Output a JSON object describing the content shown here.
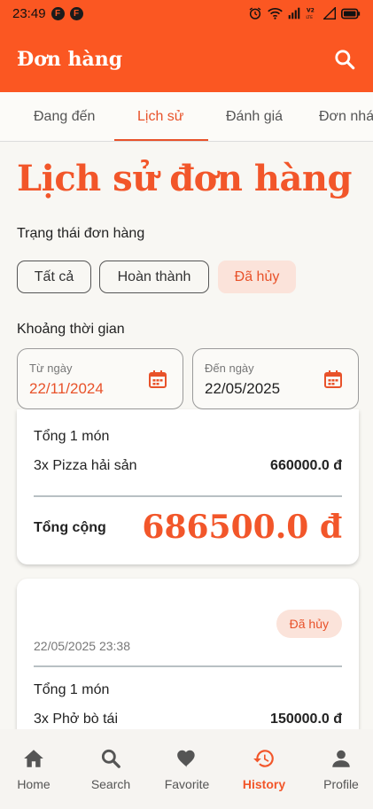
{
  "status_bar": {
    "time": "23:49",
    "icons": [
      "notification-icon",
      "notification-icon",
      "alarm-icon",
      "wifi-icon",
      "signal-icon",
      "volte-icon",
      "signal-icon",
      "battery-icon"
    ]
  },
  "app_bar": {
    "title": "Đơn hàng",
    "search_icon": "search-icon"
  },
  "tabs": [
    {
      "label": "Đang đến",
      "active": false
    },
    {
      "label": "Lịch sử",
      "active": true
    },
    {
      "label": "Đánh giá",
      "active": false
    },
    {
      "label": "Đơn nhá",
      "active": false
    }
  ],
  "page": {
    "title": "Lịch sử đơn hàng",
    "status_section_label": "Trạng thái đơn hàng",
    "filters": [
      {
        "label": "Tất cả",
        "selected": false
      },
      {
        "label": "Hoàn thành",
        "selected": false
      },
      {
        "label": "Đã hủy",
        "selected": true
      }
    ],
    "time_section_label": "Khoảng thời gian",
    "date_from": {
      "label": "Từ ngày",
      "value": "22/11/2024",
      "icon": "calendar-icon"
    },
    "date_to": {
      "label": "Đến ngày",
      "value": "22/05/2025",
      "icon": "calendar-icon"
    }
  },
  "orders": [
    {
      "items_count": "Tổng 1 món",
      "item": {
        "name": "3x Pizza hải sản",
        "price": "660000.0 đ"
      },
      "total_label": "Tổng cộng",
      "total": "686500.0 đ"
    },
    {
      "status_badge": "Đã hủy",
      "datetime": "22/05/2025 23:38",
      "items_count": "Tổng 1 món",
      "item": {
        "name": "3x Phở bò tái",
        "price": "150000.0 đ"
      }
    }
  ],
  "bottom_nav": [
    {
      "label": "Home",
      "icon": "home-icon",
      "active": false
    },
    {
      "label": "Search",
      "icon": "search-icon",
      "active": false
    },
    {
      "label": "Favorite",
      "icon": "heart-icon",
      "active": false
    },
    {
      "label": "History",
      "icon": "history-icon",
      "active": true
    },
    {
      "label": "Profile",
      "icon": "person-icon",
      "active": false
    }
  ],
  "colors": {
    "accent": "#fb5722",
    "accent_text": "#f2562a",
    "chip_selected_bg": "#fbe3da",
    "background": "#f8f7f3"
  }
}
